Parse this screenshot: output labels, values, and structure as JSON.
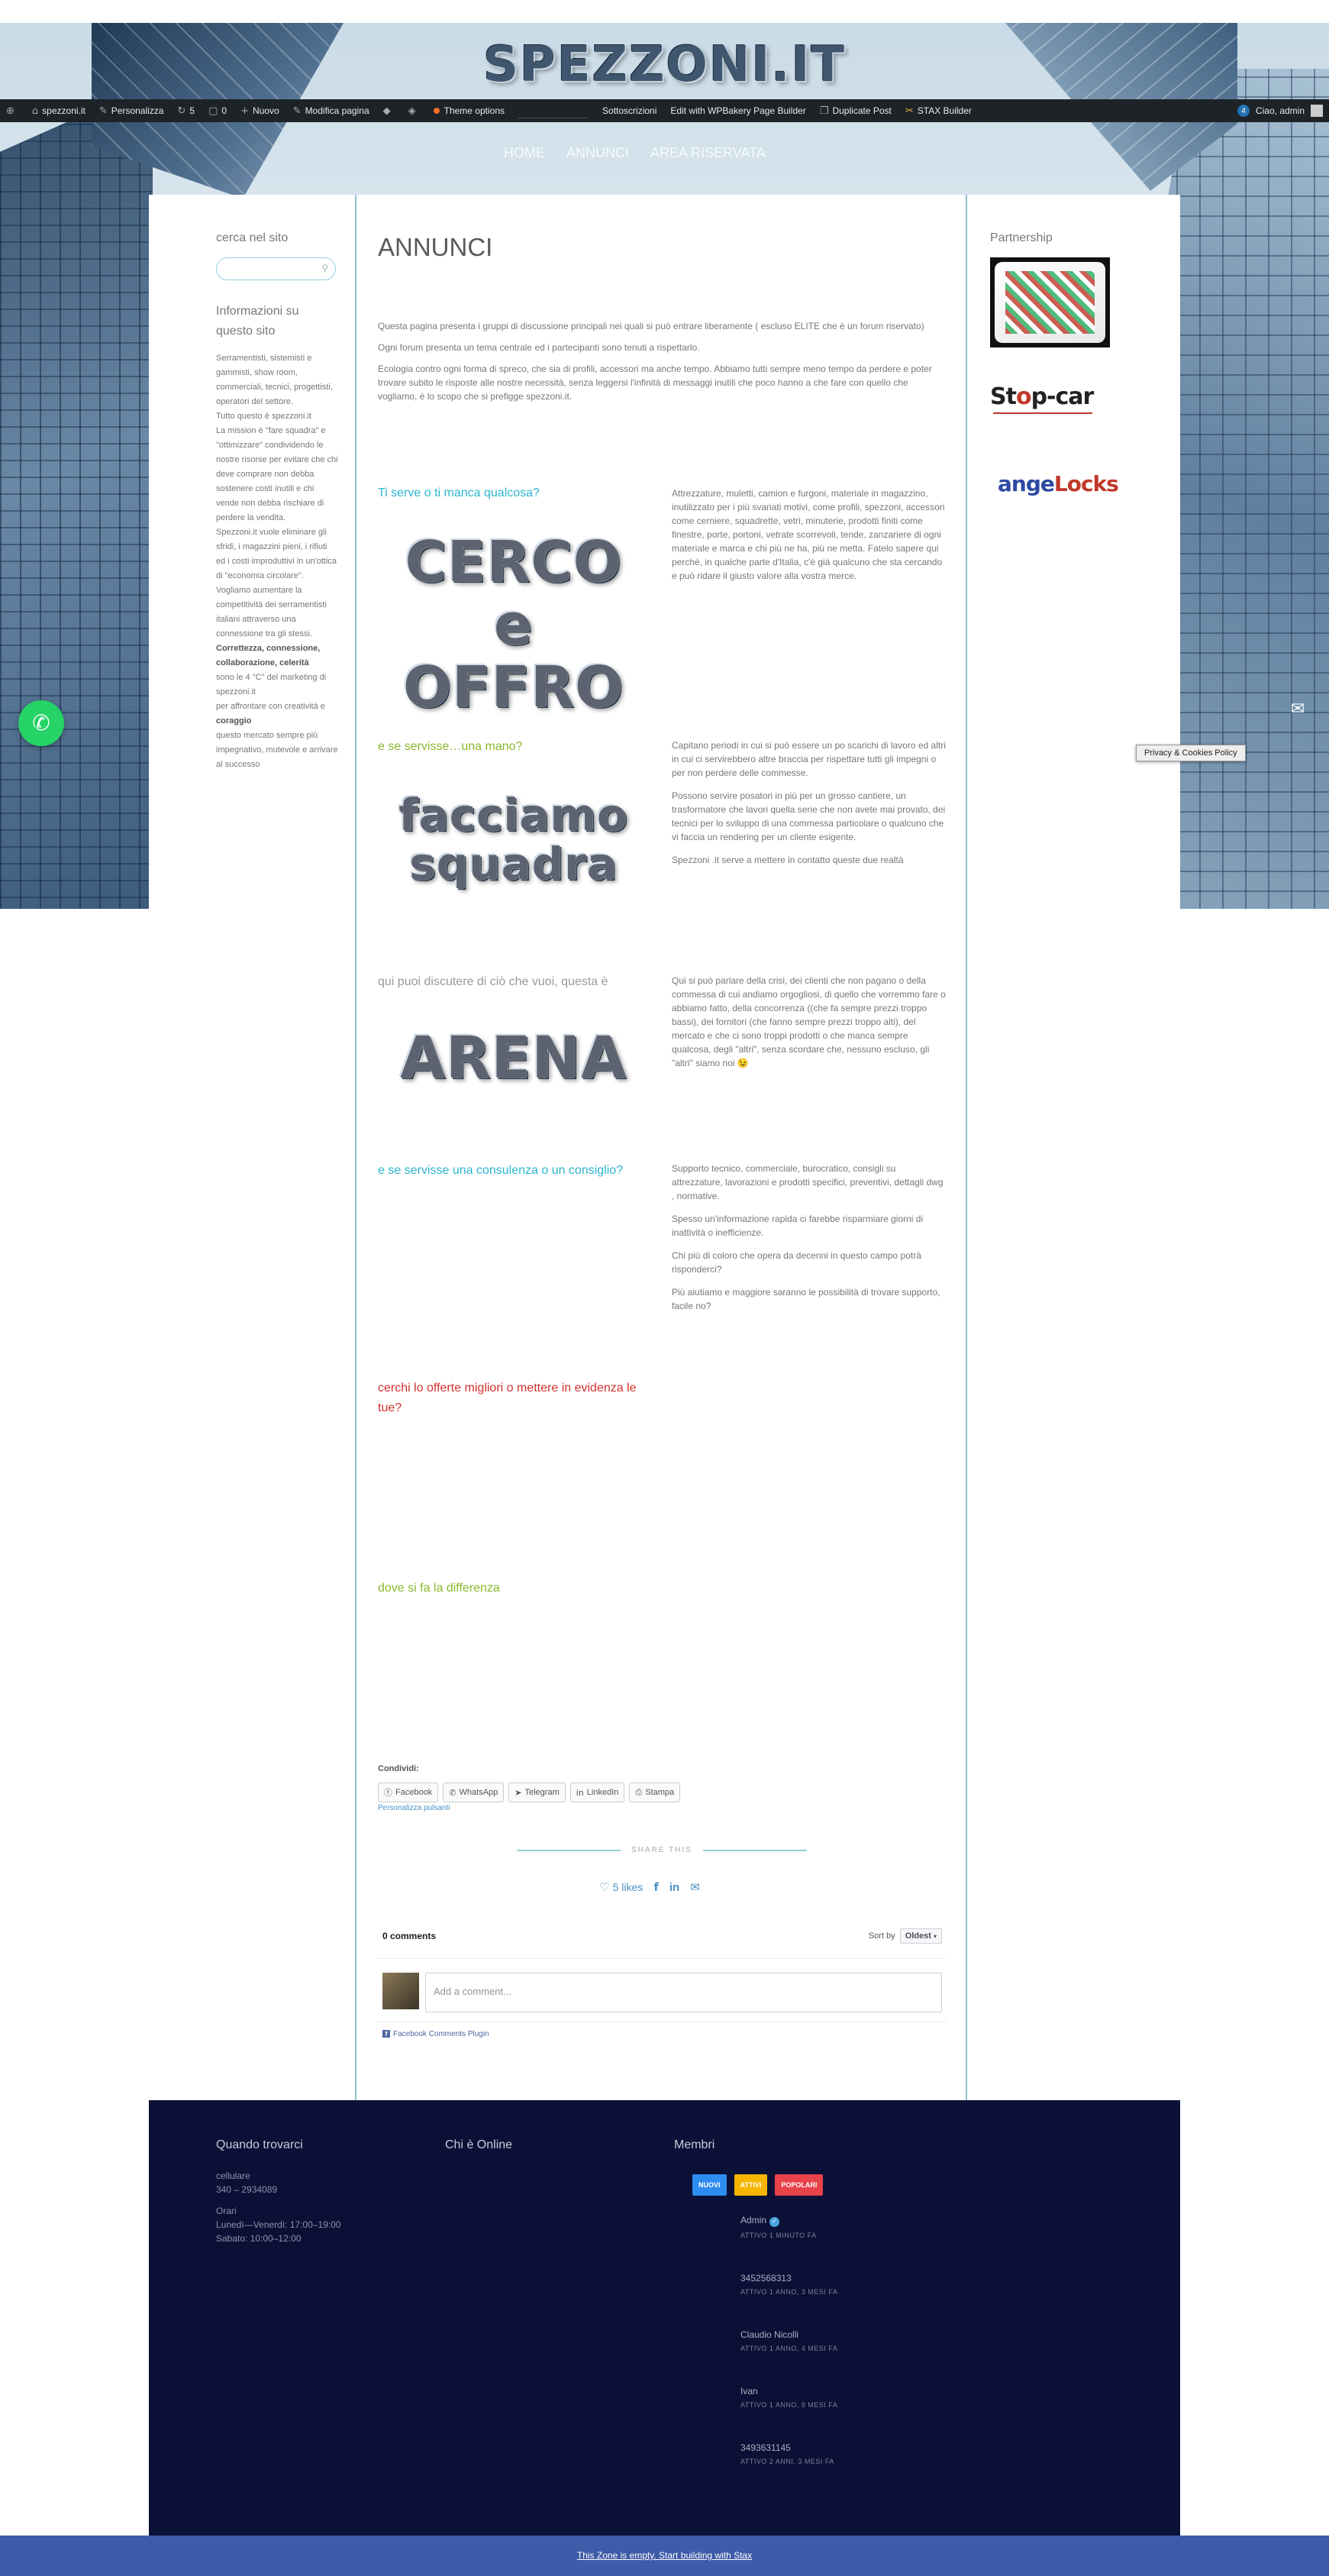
{
  "site": {
    "logo_text": "SPEZZONI.IT"
  },
  "adminbar": {
    "items": [
      {
        "icon": "wordpress-icon",
        "glyph": "⊕",
        "label": ""
      },
      {
        "icon": "home-icon",
        "glyph": "⌂",
        "label": "spezzoni.it"
      },
      {
        "icon": "brush-icon",
        "glyph": "✎",
        "label": "Personalizza"
      },
      {
        "icon": "updates-icon",
        "glyph": "↻",
        "label": "5"
      },
      {
        "icon": "comments-icon",
        "glyph": "▢",
        "label": "0"
      },
      {
        "icon": "plus-icon",
        "glyph": "+",
        "label": "Nuovo"
      },
      {
        "icon": "edit-icon",
        "glyph": "✎",
        "label": "Modifica pagina"
      },
      {
        "icon": "diamond-icon",
        "glyph": "◆",
        "label": ""
      },
      {
        "icon": "plugin-icon",
        "glyph": "◈",
        "label": ""
      }
    ],
    "theme_options": "Theme options",
    "subscriptions": "Sottoscrizioni",
    "wpbakery": "Edit with WPBakery Page Builder",
    "duplicate": "Duplicate Post",
    "stax": "STAX Builder",
    "notif_count": "4",
    "greeting": "Ciao, admin"
  },
  "nav": {
    "items": [
      "HOME",
      "ANNUNCI",
      "AREA RISERVATA"
    ]
  },
  "sidebar_left": {
    "search_title": "cerca nel sito",
    "info_title": "Informazioni su questo sito",
    "info_paragraphs": [
      "Serramentisti, sistemisti e gammisti, show room, commerciali, tecnici, progettisti, operatori del settore.",
      "Tutto questo è spezzoni.it",
      "La mission è \"fare squadra\" e \"ottimizzare\" condividendo le nostre risorse per evitare che chi deve comprare non debba sostenere costi inutili e chi vende non debba rischiare di perdere la vendita.",
      "Spezzoni.it vuole eliminare gli sfridi, i magazzini pieni, i rifiuti ed i costi improduttivi in un'ottica di \"economia circolare\".",
      "Vogliamo aumentare la competitività dei serramentisti italiani attraverso una connessione tra gli stessi."
    ],
    "info_bold": "Correttezza, connessione, collaborazione, celerità",
    "info_tail1": "sono le 4 \"C\" del marketing di spezzoni.it",
    "info_tail2": "per affrontare con creatività e",
    "info_tail_bold": "coraggio",
    "info_tail3": "questo mercato sempre più impegnativo, mutevole e arrivare al successo"
  },
  "main": {
    "title": "ANNUNCI",
    "intro": [
      "Questa pagina presenta i gruppi di discussione principali nei quali si può entrare liberamente ( escluso ELITE che è un forum riservato)",
      "Ogni forum presenta un tema centrale ed i partecipanti sono tenuti a rispettarlo.",
      "Ecologia contro ogni forma di spreco, che sia di profili, accessori ma anche tempo. Abbiamo tutti sempre meno tempo da perdere e poter trovare subito le risposte alle nostre necessità, senza leggersi l'infinità di messaggi inutili che poco hanno a che fare con quello che vogliamo, è lo scopo che si prefigge spezzoni.it."
    ],
    "sections": [
      {
        "title": "Ti serve o ti manca qualcosa?",
        "color": "#2bb5d0",
        "image_text": [
          "CERCO",
          "e",
          "OFFRO"
        ],
        "paragraphs": [
          "Attrezzature, muletti, camion e furgoni, materiale in magazzino, inutilizzato per i più svariati motivi, come profili, spezzoni, accessori come cerniere, squadrette, vetri, minuterie, prodotti finiti come finestre, porte, portoni, vetrate scorrevoli, tende, zanzariere di ogni materiale e marca e chi più ne ha, più ne metta. Fatelo sapere qui perché, in qualche parte d'Italia, c'è già qualcuno che sta cercando e può ridare il giusto valore alla vostra merce."
        ]
      },
      {
        "title": "e se servisse…una mano?",
        "color": "#8ab92d",
        "image_text": [
          "facciamo",
          "squadra"
        ],
        "paragraphs": [
          "Capitano periodi in cui si può essere un po scarichi di lavoro ed altri in cui ci servirebbero altre braccia per rispettare tutti gli impegni o per non perdere delle commesse.",
          "Possono servire posatori in più per un grosso cantiere, un trasformatore che lavori quella serie che non avete mai provato, dei tecnici per lo sviluppo di una commessa particolare o qualcuno che vi faccia un rendering per un cliente esigente.",
          "Spezzoni .it serve a mettere in contatto queste due realtà"
        ]
      },
      {
        "title": "qui puoi discutere di ciò che vuoi, questa è",
        "color": "#999999",
        "image_text": [
          "ARENA"
        ],
        "paragraphs": [
          "Qui si può parlare della crisi, dei clienti che non pagano o della commessa di cui andiamo orgogliosi, di quello che vorremmo fare o abbiamo fatto, della concorrenza ((che fa sempre prezzi troppo bassi), dei fornitori (che fanno sempre prezzi troppo alti), del mercato e che ci sono troppi prodotti o che manca sempre qualcosa, degli \"altri\", senza scordare che, nessuno escluso, gli \"altri\" siamo noi 😉"
        ]
      },
      {
        "title": "e se servisse una consulenza o un consiglio?",
        "color": "#2bb5d0",
        "image_text": [],
        "paragraphs": [
          "Supporto tecnico, commerciale, burocratico, consigli su attrezzature, lavorazioni e prodotti specifici, preventivi, dettagli dwg , normative.",
          "Spesso un'informazione rapida ci farebbe risparmiare giorni di inattività o inefficienze.",
          "Chi più di coloro che opera da decenni in questo campo potrà risponderci?",
          "Più aiutiamo e maggiore saranno le possibilità di trovare supporto, facile no?"
        ]
      },
      {
        "title": "cerchi lo offerte migliori o mettere in evidenza le tue?",
        "color": "#d0312d",
        "image_text": [],
        "paragraphs": []
      },
      {
        "title": "dove si fa la differenza",
        "color": "#8ab92d",
        "image_text": [],
        "paragraphs": []
      }
    ],
    "share": {
      "label": "Condividi:",
      "buttons": [
        {
          "name": "facebook",
          "icon": "facebook-icon",
          "glyph": "ⓕ",
          "label": "Facebook"
        },
        {
          "name": "whatsapp",
          "icon": "whatsapp-icon",
          "glyph": "✆",
          "label": "WhatsApp"
        },
        {
          "name": "telegram",
          "icon": "telegram-icon",
          "glyph": "➤",
          "label": "Telegram"
        },
        {
          "name": "linkedin",
          "icon": "linkedin-icon",
          "glyph": "in",
          "label": "LinkedIn"
        },
        {
          "name": "print",
          "icon": "print-icon",
          "glyph": "⎙",
          "label": "Stampa"
        }
      ],
      "customize": "Personalizza pulsanti",
      "share_this": "SHARE THIS",
      "likes": "5 likes"
    },
    "comments": {
      "count": "0 comments",
      "sort_label": "Sort by",
      "sort_value": "Oldest",
      "placeholder": "Add a comment...",
      "plugin": "Facebook Comments Plugin"
    }
  },
  "sidebar_right": {
    "title": "Partnership",
    "partners": [
      "Stop-car",
      "angeLocks"
    ]
  },
  "footer": {
    "when_title": "Quando trovarci",
    "online_title": "Chi è Online",
    "members_title": "Membri",
    "cell_label": "cellulare",
    "cell_value": "340 – 2934089",
    "hours_label": "Orari",
    "hours_weekdays": "Lunedì—Venerdì: 17:00–19:00",
    "hours_saturday": "Sabato: 10:00–12:00",
    "member_tabs": [
      {
        "label": "NUOVI",
        "color": "#2d8cf0"
      },
      {
        "label": "ATTIVI",
        "color": "#f7b500"
      },
      {
        "label": "POPOLARI",
        "color": "#e9424b"
      }
    ],
    "members": [
      {
        "name": "Admin",
        "status": "ATTIVO 1 MINUTO FA",
        "verified": true
      },
      {
        "name": "3452568313",
        "status": "ATTIVO 1 ANNO, 3 MESI FA",
        "verified": false
      },
      {
        "name": "Claudio Nicolli",
        "status": "ATTIVO 1 ANNO, 4 MESI FA",
        "verified": false
      },
      {
        "name": "Ivan",
        "status": "ATTIVO 1 ANNO, 9 MESI FA",
        "verified": false
      },
      {
        "name": "3493631145",
        "status": "ATTIVO 2 ANNI, 3 MESI FA",
        "verified": false
      }
    ]
  },
  "bottom_zone": {
    "text": "This Zone is empty. Start building with Stax"
  },
  "floating": {
    "privacy": "Privacy & Cookies Policy"
  },
  "colors": {
    "accent": "#8fc3cc",
    "footer_bg": "#0a1036",
    "bottom_bar": "#3e5aa8"
  }
}
